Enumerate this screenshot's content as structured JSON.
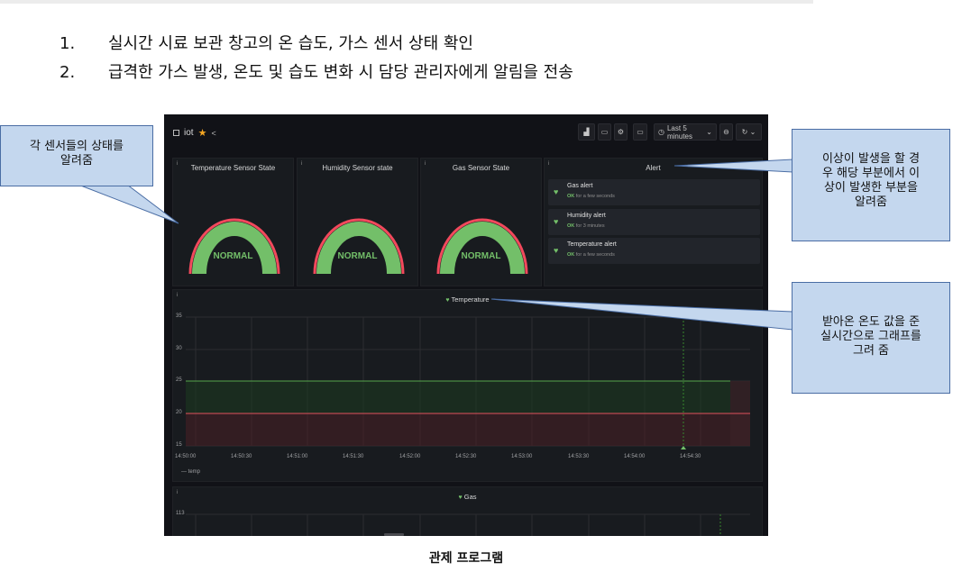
{
  "list": [
    {
      "num": "1.",
      "text": "실시간 시료 보관 창고의 온 습도, 가스 센서 상태 확인"
    },
    {
      "num": "2.",
      "text": "급격한 가스 발생, 온도 및 습도 변화 시 담당 관리자에게 알림을 전송"
    }
  ],
  "dashboard": {
    "title": "iot",
    "time_range": "Last 5 minutes",
    "gauges": [
      {
        "title": "Temperature Sensor State",
        "value": "NORMAL"
      },
      {
        "title": "Humidity Sensor state",
        "value": "NORMAL"
      },
      {
        "title": "Gas Sensor State",
        "value": "NORMAL"
      }
    ],
    "alert_panel": {
      "title": "Alert",
      "items": [
        {
          "name": "Gas alert",
          "state": "OK",
          "since": "for a few seconds"
        },
        {
          "name": "Humidity alert",
          "state": "OK",
          "since": "for 3 minutes"
        },
        {
          "name": "Temperature alert",
          "state": "OK",
          "since": "for a few seconds"
        }
      ]
    },
    "temperature_panel": {
      "title": "Temperature",
      "y_ticks": [
        "35",
        "30",
        "25",
        "20",
        "15"
      ],
      "x_ticks": [
        "14:50:00",
        "14:50:30",
        "14:51:00",
        "14:51:30",
        "14:52:00",
        "14:52:30",
        "14:53:00",
        "14:53:30",
        "14:54:00",
        "14:54:30"
      ],
      "legend": "temp"
    },
    "gas_panel": {
      "title": "Gas",
      "y_ticks": [
        "113"
      ]
    }
  },
  "callouts": {
    "sensors": "각 센서들의 상태를\n알려줌",
    "alert": "이상이 발생을 할 경\n우 해당 부분에서 이\n상이 발생한 부분을\n알려줌",
    "graph": "받아온 온도 값을 준\n실시간으로 그래프를\n그려 줌"
  },
  "caption": "관제 프로그램",
  "colors": {
    "dashboard_bg": "#111217",
    "panel_bg": "#181b1f",
    "ok_green": "#73bf69",
    "threshold_red": "#f2495c",
    "callout_fill": "#c4d7ee",
    "callout_border": "#4a6da4"
  }
}
